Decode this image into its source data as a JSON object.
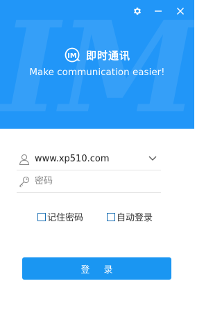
{
  "colors": {
    "banner": "#2196f8",
    "button": "#1a96f2",
    "text": "#222222",
    "placeholder": "#8a8a8a",
    "checkbox_border": "#1a6fb3"
  },
  "window": {
    "settings_icon": "gear-icon",
    "minimize_icon": "minimize-icon",
    "close_icon": "close-icon"
  },
  "banner": {
    "watermark_text": "IM",
    "logo_text": "IM",
    "app_name": "即时通讯",
    "slogan": "Make communication easier!"
  },
  "form": {
    "username_icon": "user-icon",
    "username_value": "www.xp510.com",
    "password_icon": "key-icon",
    "password_placeholder": "密码",
    "dropdown_icon": "chevron-down-icon",
    "remember_password_label": "记住密码",
    "remember_password_checked": false,
    "auto_login_label": "自动登录",
    "auto_login_checked": false,
    "login_button_label": "登 录"
  }
}
